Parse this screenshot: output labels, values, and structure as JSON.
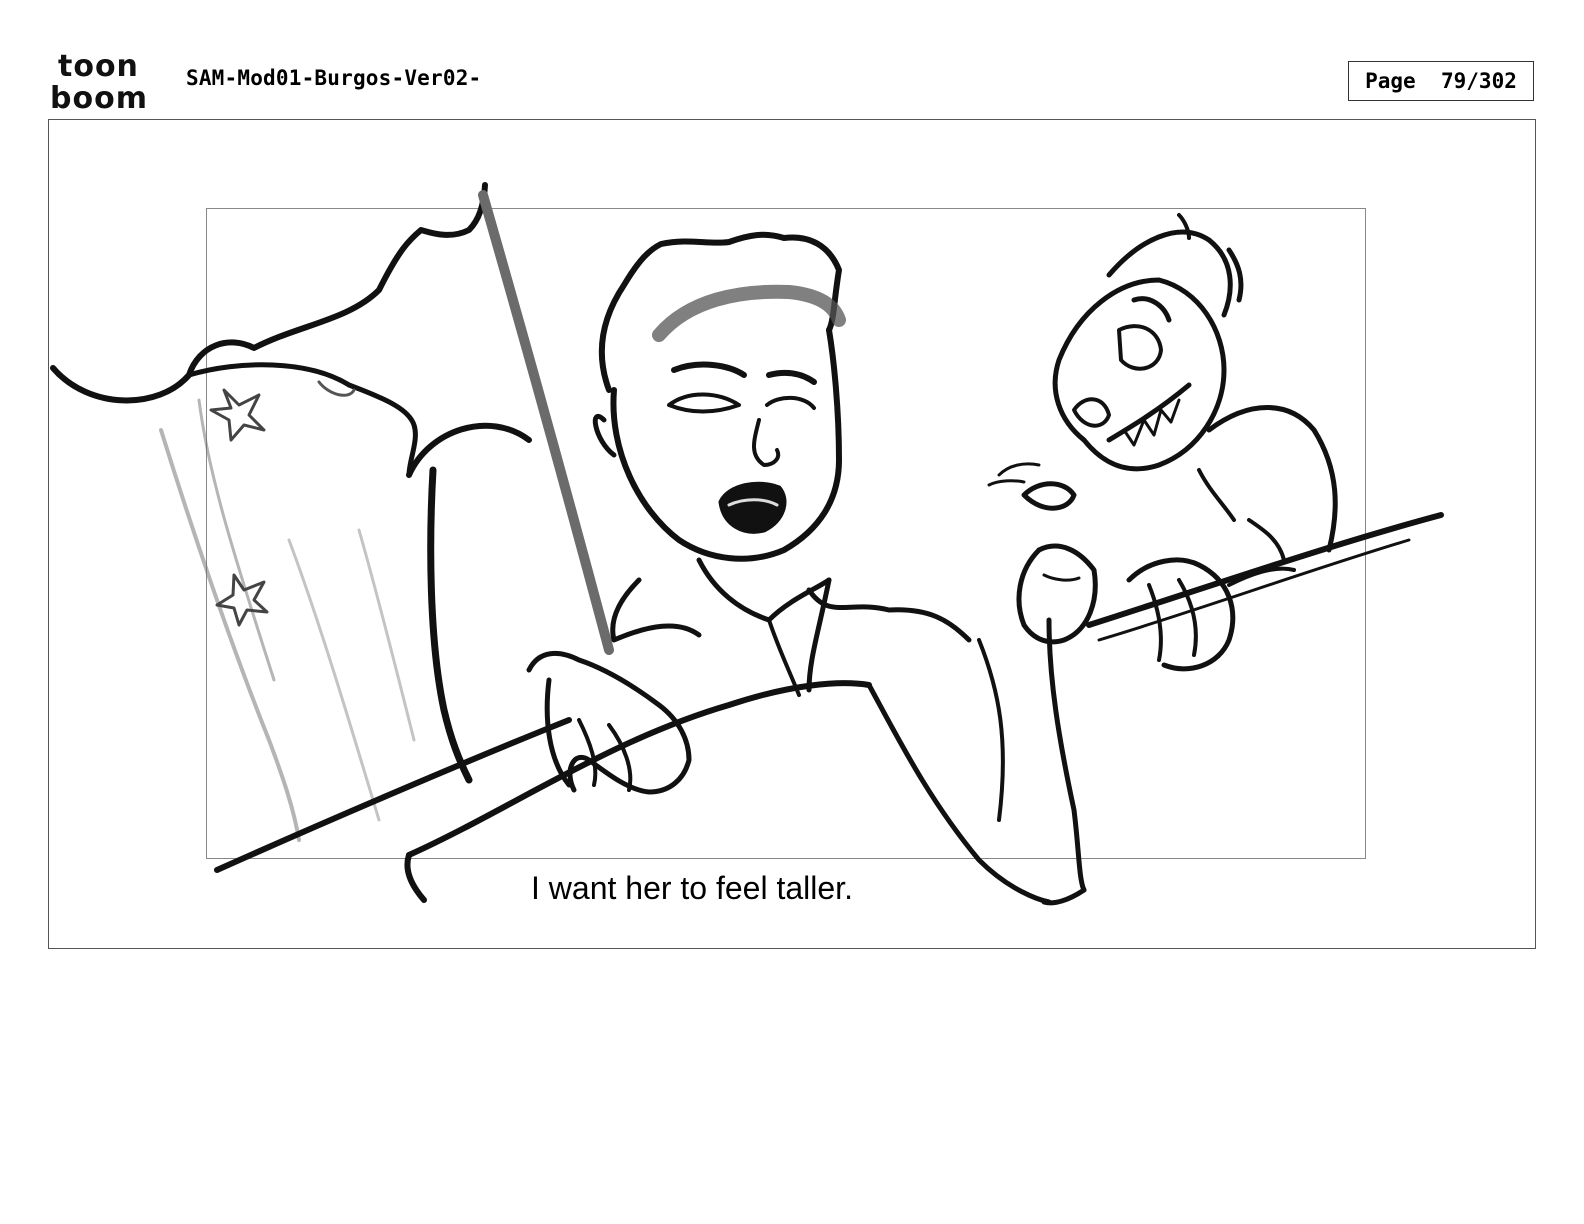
{
  "header": {
    "logo_top": "toon",
    "logo_bottom": "boom",
    "document_title": "SAM-Mod01-Burgos-Ver02-",
    "page_label": "Page",
    "page_number": "79/302"
  },
  "panel": {
    "dialogue": "I want her to feel taller.",
    "sketch_icons": [
      "curtain-sketch",
      "man-character-sketch",
      "cat-creature-sketch",
      "railing-sketch"
    ]
  },
  "colors": {
    "ink": "#111111",
    "frame": "#555555",
    "safe_frame": "#888888",
    "shadow": "#6b6b6b"
  }
}
